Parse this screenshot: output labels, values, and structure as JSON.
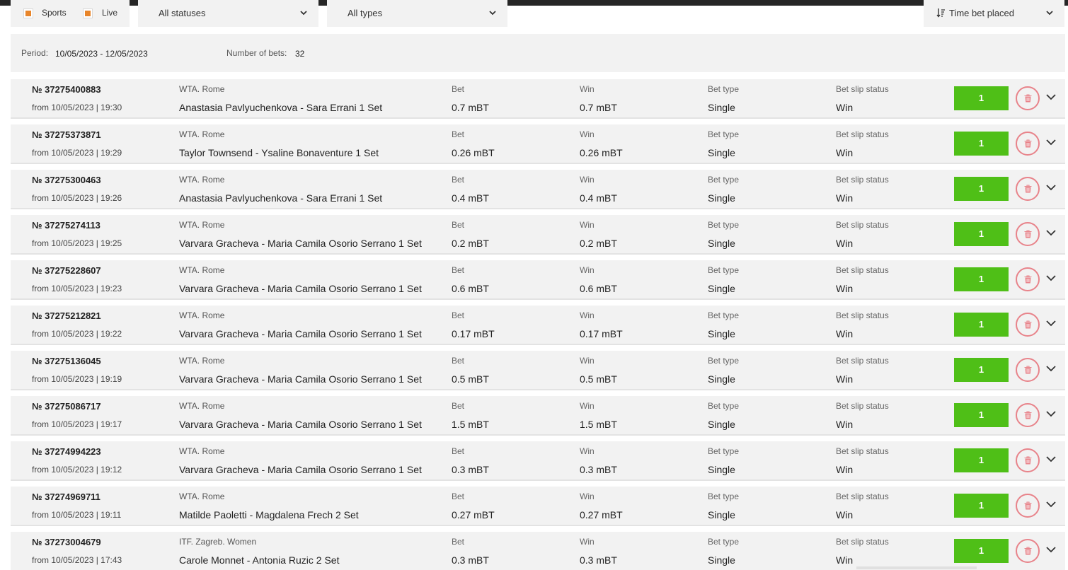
{
  "filters": {
    "sports_label": "Sports",
    "live_label": "Live",
    "status_selected": "All statuses",
    "type_selected": "All types",
    "sort_selected": "Time bet placed",
    "checkbox_color": "#e8852a"
  },
  "summary": {
    "period_label": "Period:",
    "period_value": "10/05/2023 - 12/05/2023",
    "count_label": "Number of bets:",
    "count_value": "32"
  },
  "columns": {
    "bet": "Bet",
    "win": "Win",
    "type": "Bet type",
    "status": "Bet slip status"
  },
  "colors": {
    "accent_green": "#4fbf17",
    "delete_red": "#e8838a",
    "row_bg": "#f2f2f2"
  },
  "bets": [
    {
      "no": "№ 37275400883",
      "date": "from 10/05/2023 | 19:30",
      "league": "WTA. Rome",
      "match": "Anastasia Pavlyuchenkova - Sara Errani 1 Set",
      "bet": "0.7 mBT",
      "win": "0.7 mBT",
      "type": "Single",
      "status": "Win",
      "count": "1"
    },
    {
      "no": "№ 37275373871",
      "date": "from 10/05/2023 | 19:29",
      "league": "WTA. Rome",
      "match": "Taylor Townsend - Ysaline Bonaventure 1 Set",
      "bet": "0.26 mBT",
      "win": "0.26 mBT",
      "type": "Single",
      "status": "Win",
      "count": "1"
    },
    {
      "no": "№ 37275300463",
      "date": "from 10/05/2023 | 19:26",
      "league": "WTA. Rome",
      "match": "Anastasia Pavlyuchenkova - Sara Errani 1 Set",
      "bet": "0.4 mBT",
      "win": "0.4 mBT",
      "type": "Single",
      "status": "Win",
      "count": "1"
    },
    {
      "no": "№ 37275274113",
      "date": "from 10/05/2023 | 19:25",
      "league": "WTA. Rome",
      "match": "Varvara Gracheva - Maria Camila Osorio Serrano 1 Set",
      "bet": "0.2 mBT",
      "win": "0.2 mBT",
      "type": "Single",
      "status": "Win",
      "count": "1"
    },
    {
      "no": "№ 37275228607",
      "date": "from 10/05/2023 | 19:23",
      "league": "WTA. Rome",
      "match": "Varvara Gracheva - Maria Camila Osorio Serrano 1 Set",
      "bet": "0.6 mBT",
      "win": "0.6 mBT",
      "type": "Single",
      "status": "Win",
      "count": "1"
    },
    {
      "no": "№ 37275212821",
      "date": "from 10/05/2023 | 19:22",
      "league": "WTA. Rome",
      "match": "Varvara Gracheva - Maria Camila Osorio Serrano 1 Set",
      "bet": "0.17 mBT",
      "win": "0.17 mBT",
      "type": "Single",
      "status": "Win",
      "count": "1"
    },
    {
      "no": "№ 37275136045",
      "date": "from 10/05/2023 | 19:19",
      "league": "WTA. Rome",
      "match": "Varvara Gracheva - Maria Camila Osorio Serrano 1 Set",
      "bet": "0.5 mBT",
      "win": "0.5 mBT",
      "type": "Single",
      "status": "Win",
      "count": "1"
    },
    {
      "no": "№ 37275086717",
      "date": "from 10/05/2023 | 19:17",
      "league": "WTA. Rome",
      "match": "Varvara Gracheva - Maria Camila Osorio Serrano 1 Set",
      "bet": "1.5 mBT",
      "win": "1.5 mBT",
      "type": "Single",
      "status": "Win",
      "count": "1"
    },
    {
      "no": "№ 37274994223",
      "date": "from 10/05/2023 | 19:12",
      "league": "WTA. Rome",
      "match": "Varvara Gracheva - Maria Camila Osorio Serrano 1 Set",
      "bet": "0.3 mBT",
      "win": "0.3 mBT",
      "type": "Single",
      "status": "Win",
      "count": "1"
    },
    {
      "no": "№ 37274969711",
      "date": "from 10/05/2023 | 19:11",
      "league": "WTA. Rome",
      "match": "Matilde Paoletti - Magdalena Frech 2 Set",
      "bet": "0.27 mBT",
      "win": "0.27 mBT",
      "type": "Single",
      "status": "Win",
      "count": "1"
    },
    {
      "no": "№ 37273004679",
      "date": "from 10/05/2023 | 17:43",
      "league": "ITF. Zagreb. Women",
      "match": "Carole Monnet - Antonia Ruzic 2 Set",
      "bet": "0.3 mBT",
      "win": "0.3 mBT",
      "type": "Single",
      "status": "Win",
      "count": "1"
    }
  ]
}
